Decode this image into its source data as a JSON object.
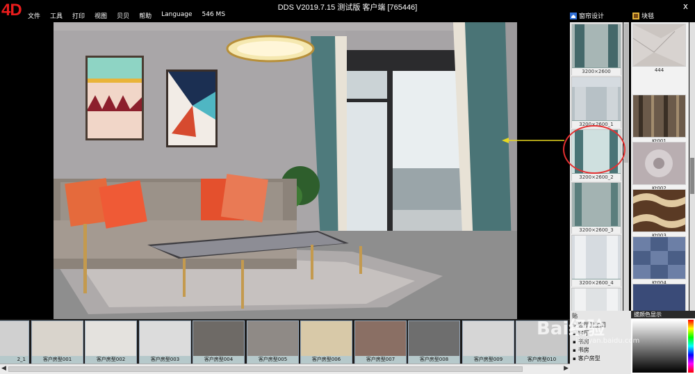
{
  "app": {
    "logo": "4D",
    "title": "DDS  V2019.7.15 测试版 客户端 [765446]",
    "close_glyph": "x"
  },
  "menu": [
    "文件",
    "工具",
    "打印",
    "视图",
    "贝贝",
    "帮助",
    "Language",
    "546 MS"
  ],
  "panel_tabs": {
    "curtain_design": "窗帘设计",
    "fabric": "块毯"
  },
  "curtains": [
    {
      "label": "3200×2600"
    },
    {
      "label": "3200×2600_1"
    },
    {
      "label": "3200×2600_2"
    },
    {
      "label": "3200×2600_3"
    },
    {
      "label": "3200×2600_4"
    },
    {
      "label": ""
    }
  ],
  "fabrics": [
    {
      "label": "444",
      "color": "#c9c2be"
    },
    {
      "label": "Kt001",
      "color": "#6b5a4a"
    },
    {
      "label": "Kt002",
      "color": "#b9aeb1"
    },
    {
      "label": "Kt003",
      "color": "#5a3a24"
    },
    {
      "label": "Kt004",
      "color": "#4a5e86"
    },
    {
      "label": "",
      "color": "#3a4b78"
    }
  ],
  "rooms": [
    {
      "label": "2_1"
    },
    {
      "label": "客户房型001"
    },
    {
      "label": "客户房型002"
    },
    {
      "label": "客户房型003"
    },
    {
      "label": "客户房型004"
    },
    {
      "label": "客户房型005"
    },
    {
      "label": "客户房型006"
    },
    {
      "label": "客户房型007"
    },
    {
      "label": "客户房型008"
    },
    {
      "label": "客户房型009"
    },
    {
      "label": "客户房型010"
    }
  ],
  "room_types": {
    "header": "贴",
    "items": [
      "客厅卫生间",
      "客厅",
      "书房",
      "书房",
      "客户房型"
    ]
  },
  "color_panel": {
    "header": "拔颜色显示"
  },
  "watermark": {
    "main": "Bai经验",
    "sub": "jingyan.baidu.com"
  }
}
